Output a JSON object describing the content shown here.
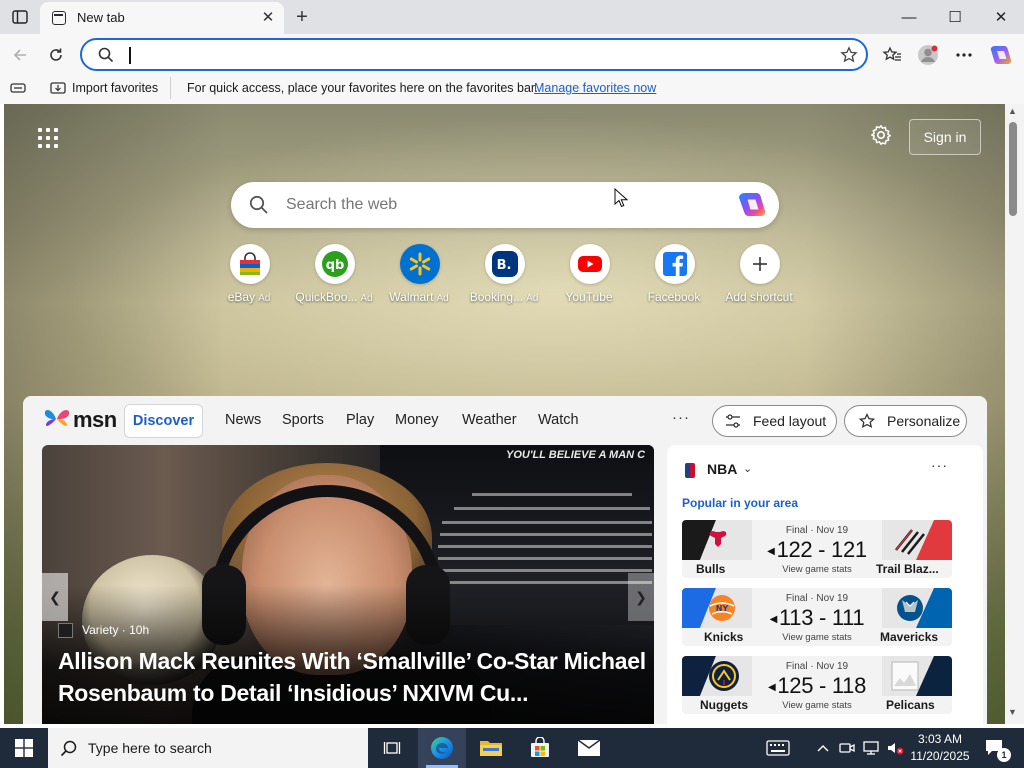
{
  "browser": {
    "tab_title": "New tab",
    "tab_close_glyph": "✕",
    "new_tab_glyph": "+",
    "window_buttons": {
      "minimize": "—",
      "maximize": "☐",
      "close": "✕"
    },
    "address_value": "",
    "favorites_bar": {
      "import_label": "Import favorites",
      "message": "For quick access, place your favorites here on the favorites bar.",
      "manage_link": "Manage favorites now"
    }
  },
  "ntp": {
    "sign_in_label": "Sign in",
    "search_placeholder": "Search the web",
    "shortcuts": [
      {
        "label": "eBay",
        "ad": "Ad",
        "icon": "ebay-bag-icon"
      },
      {
        "label": "QuickBoo...",
        "ad": "Ad",
        "icon": "quickbooks-icon"
      },
      {
        "label": "Walmart",
        "ad": "Ad",
        "icon": "walmart-spark-icon"
      },
      {
        "label": "Booking...",
        "ad": "Ad",
        "icon": "booking-icon"
      },
      {
        "label": "YouTube",
        "ad": "",
        "icon": "youtube-icon"
      },
      {
        "label": "Facebook",
        "ad": "",
        "icon": "facebook-icon"
      },
      {
        "label": "Add shortcut",
        "ad": "",
        "icon": "plus-icon"
      }
    ]
  },
  "feed": {
    "logo_text": "msn",
    "tabs": [
      "Discover",
      "News",
      "Sports",
      "Play",
      "Money",
      "Weather",
      "Watch"
    ],
    "more_glyph": "···",
    "feed_layout_label": "Feed layout",
    "personalize_label": "Personalize",
    "hero": {
      "source": "Variety · 10h",
      "title": "Allison Mack Reunites With ‘Smallville’ Co-Star Michael Rosenbaum to Detail ‘Insidious’ NXIVM Cu...",
      "poster_headline": "YOU'LL BELIEVE A MAN C",
      "prev_glyph": "❮",
      "next_glyph": "❯"
    },
    "nba": {
      "title": "NBA",
      "subtitle": "Popular in your area",
      "more_glyph": "···",
      "games": [
        {
          "status": "Final · Nov 19",
          "score": "122 - 121",
          "view": "View game stats",
          "home": "Bulls",
          "away": "Trail Blaz...",
          "home_color": "#1a1a1a",
          "home_accent": "#ce1141",
          "away_color": "#e03a3e",
          "away_accent": "#1a1a1a"
        },
        {
          "status": "Final · Nov 19",
          "score": "113 - 111",
          "view": "View game stats",
          "home": "Knicks",
          "away": "Mavericks",
          "home_color": "#1d6ae5",
          "home_accent": "#f58426",
          "away_color": "#0064b1",
          "away_accent": "#00538c"
        },
        {
          "status": "Final · Nov 19",
          "score": "125 - 118",
          "view": "View game stats",
          "home": "Nuggets",
          "away": "Pelicans",
          "home_color": "#0e2240",
          "home_accent": "#fec524",
          "away_color": "#0c2340",
          "away_accent": "#c8102e"
        }
      ]
    }
  },
  "taskbar": {
    "search_placeholder": "Type here to search",
    "time": "3:03 AM",
    "date": "11/20/2025",
    "notification_count": "1"
  },
  "colors": {
    "accent": "#1b5fcf",
    "address_border": "#1e68d6",
    "taskbar_bg": "#1f2a3a"
  }
}
